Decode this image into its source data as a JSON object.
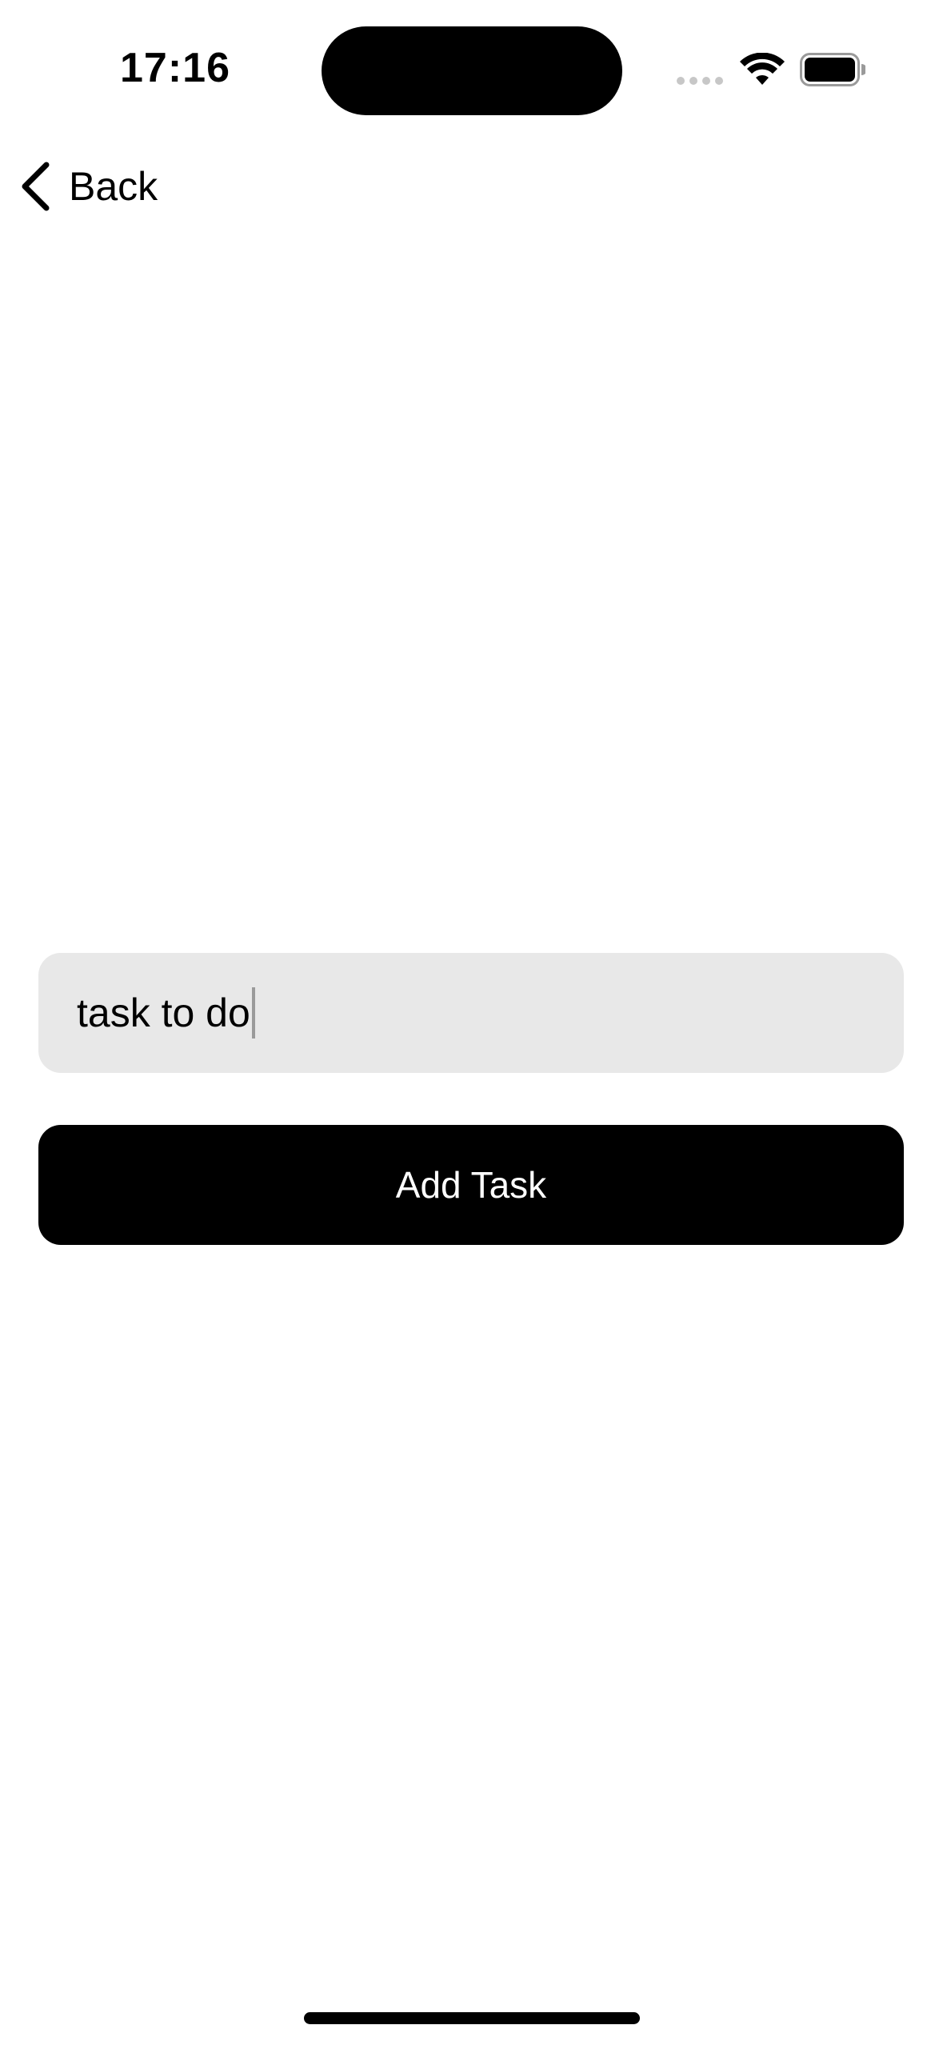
{
  "status_bar": {
    "time": "17:16",
    "icons": [
      "cellular-signal-icon",
      "wifi-icon",
      "battery-icon"
    ]
  },
  "nav": {
    "back_label": "Back",
    "back_icon": "chevron-left-icon"
  },
  "form": {
    "task_input_value": "task to do",
    "add_button_label": "Add Task"
  },
  "colors": {
    "background": "#ffffff",
    "input_background": "#e8e8e8",
    "button_background": "#000000",
    "button_text": "#ffffff"
  }
}
